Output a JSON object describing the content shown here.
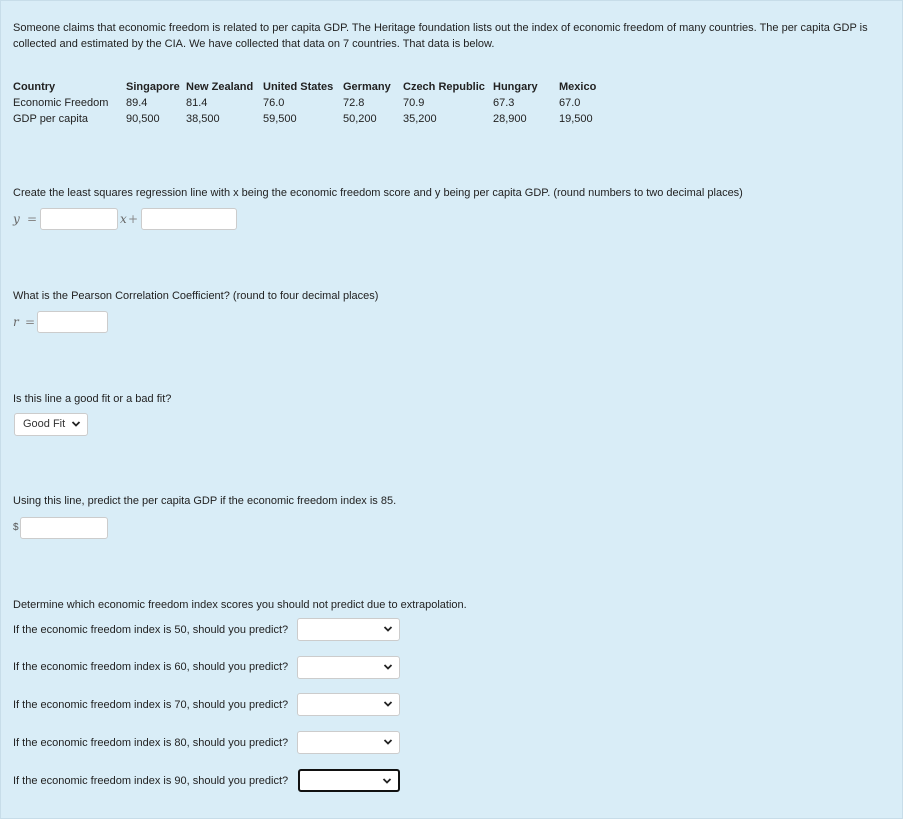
{
  "intro": "Someone claims that economic freedom is related to per capita GDP. The Heritage foundation lists out the index of economic freedom of many countries. The per capita GDP is collected and estimated by the CIA. We have collected that data on 7 countries. That data is below.",
  "table": {
    "headers": [
      "Country",
      "Singapore",
      "New Zealand",
      "United States",
      "Germany",
      "Czech Republic",
      "Hungary",
      "Mexico"
    ],
    "rows": [
      [
        "Economic Freedom",
        "89.4",
        "81.4",
        "76.0",
        "72.8",
        "70.9",
        "67.3",
        "67.0"
      ],
      [
        "GDP per capita",
        "90,500",
        "38,500",
        "59,500",
        "50,200",
        "35,200",
        "28,900",
        "19,500"
      ]
    ]
  },
  "q1": {
    "prompt": "Create the least squares regression line with x being the economic freedom score and y being per capita GDP. (round numbers to two decimal places)",
    "y_symbol": "y",
    "equals": "=",
    "x_symbol": "x",
    "plus": "+"
  },
  "q2": {
    "prompt": "What is the Pearson Correlation Coefficient? (round to four decimal places)",
    "r_symbol": "r",
    "equals": "="
  },
  "q3": {
    "prompt": "Is this line a good fit or a bad fit?",
    "selected": "Good Fit"
  },
  "q4": {
    "prompt": "Using this line, predict the per capita GDP if the economic freedom index is 85.",
    "currency": "$"
  },
  "q5": {
    "prompt": "Determine which economic freedom index scores you should not predict due to extrapolation.",
    "items": [
      {
        "label": "If the economic freedom index is 50, should you predict?"
      },
      {
        "label": "If the economic freedom index is 60, should you predict?"
      },
      {
        "label": "If the economic freedom index is 70, should you predict?"
      },
      {
        "label": "If the economic freedom index is 80, should you predict?"
      },
      {
        "label": "If the economic freedom index is 90, should you predict?"
      }
    ]
  }
}
